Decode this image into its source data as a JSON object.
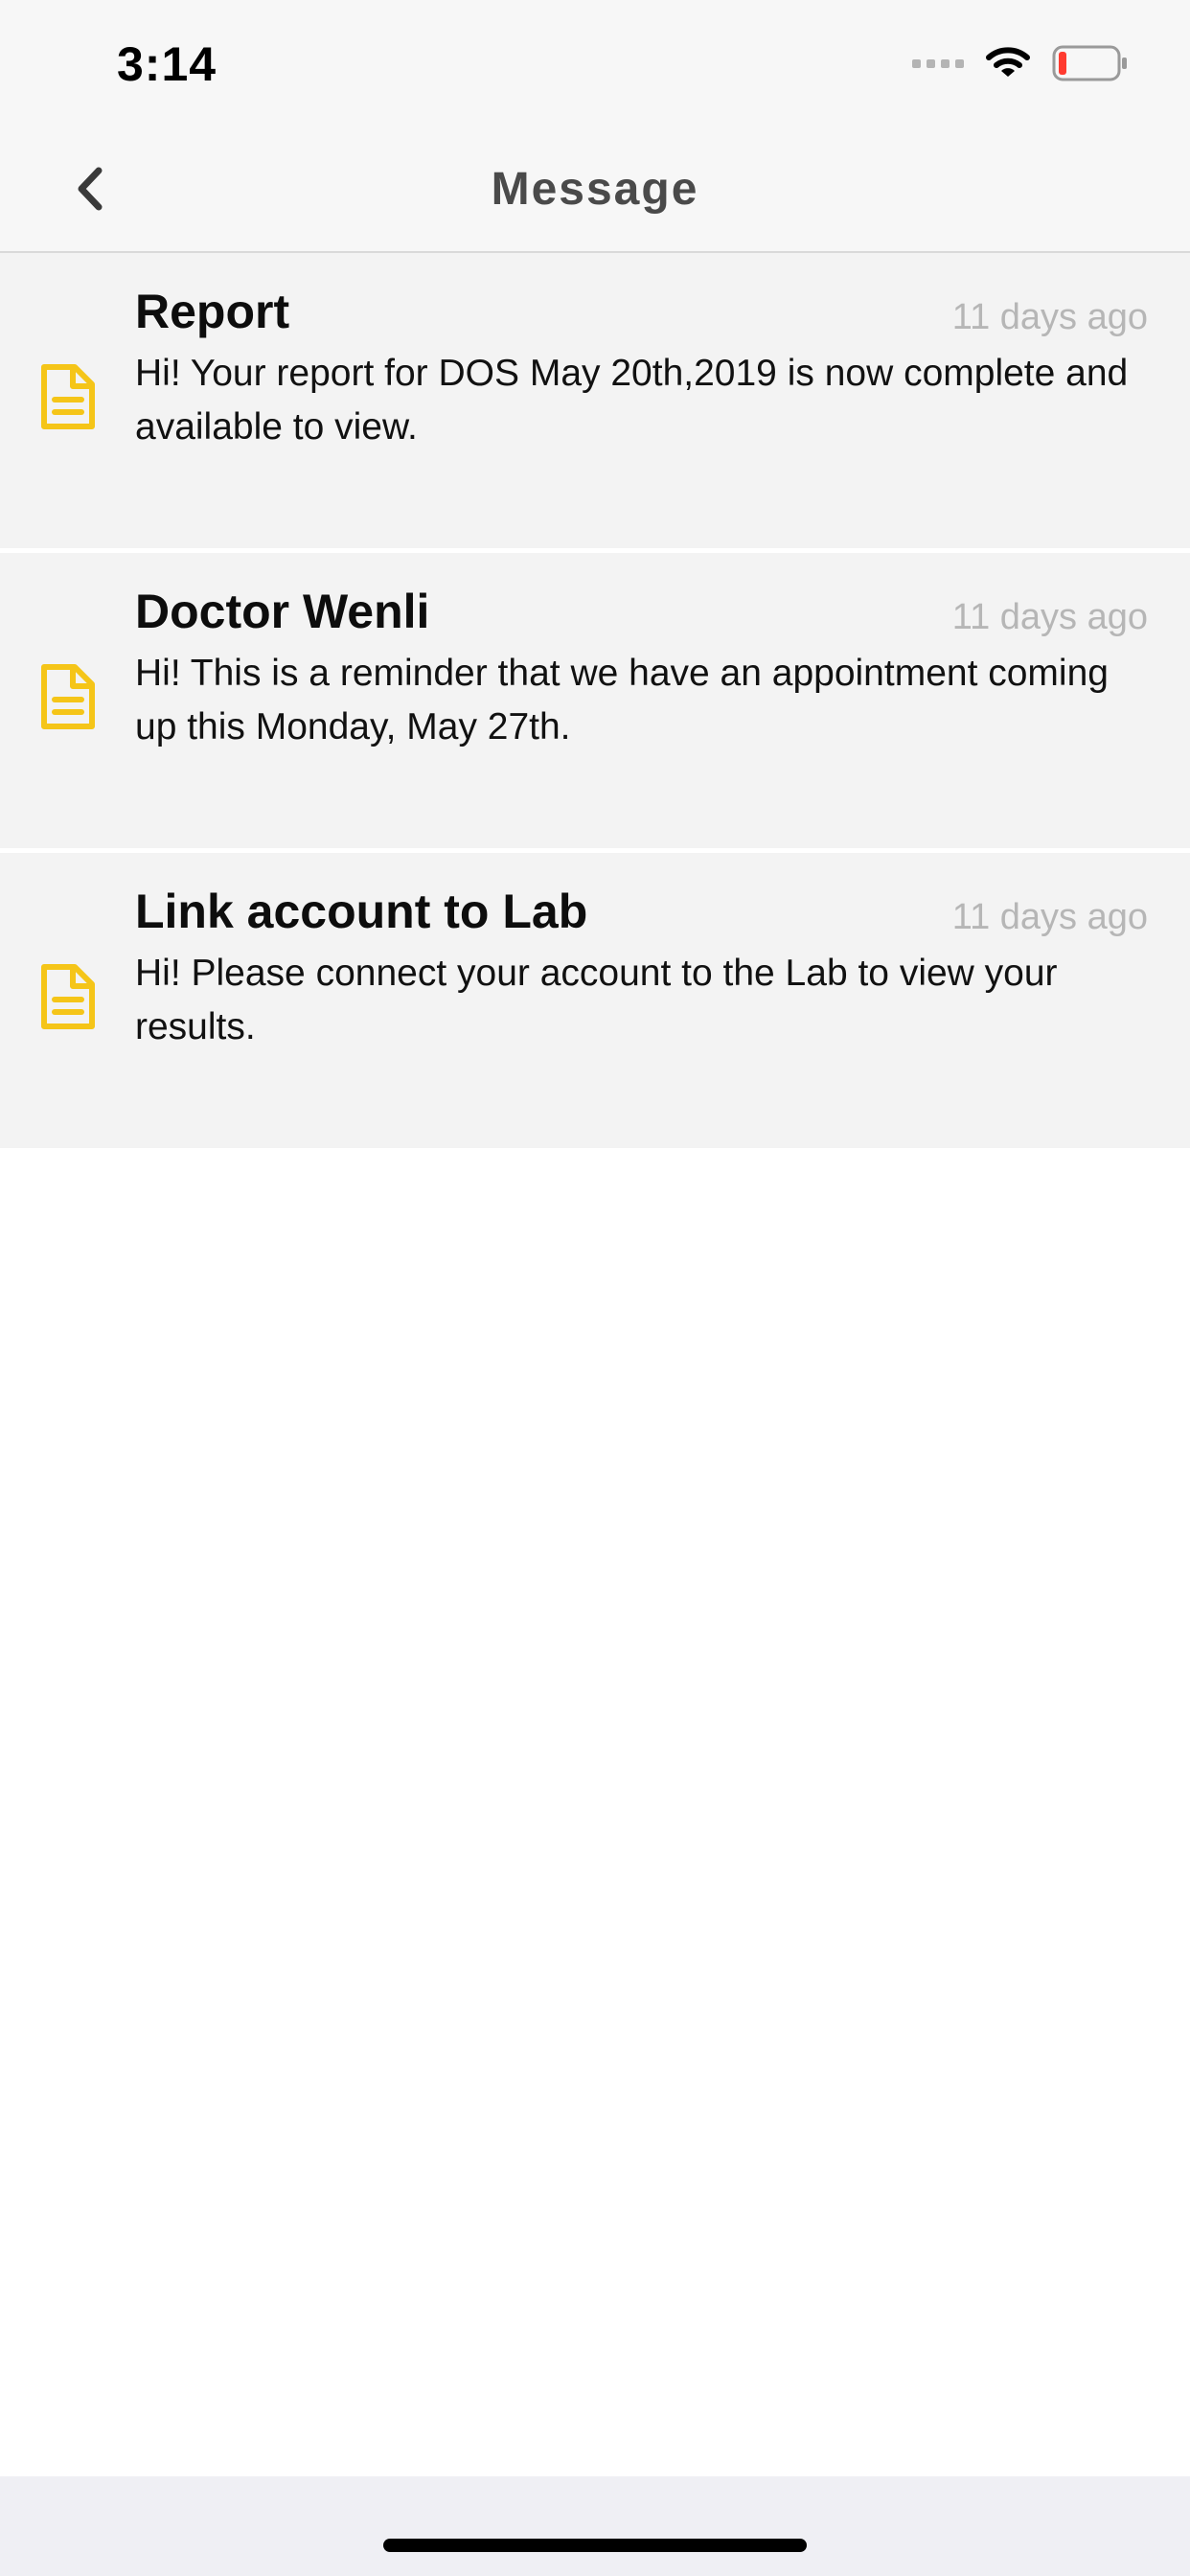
{
  "status_bar": {
    "time": "3:14"
  },
  "nav": {
    "title": "Message"
  },
  "colors": {
    "accent_icon": "#f5c518",
    "battery_low": "#ff3b30"
  },
  "messages": [
    {
      "title": "Report",
      "time": "11 days ago",
      "body": "Hi! Your report for DOS May 20th,2019 is now complete and available to view.",
      "icon": "document-icon"
    },
    {
      "title": "Doctor Wenli",
      "time": "11 days ago",
      "body": "Hi! This is a reminder that we have an appointment coming up this Monday, May 27th.",
      "icon": "document-icon"
    },
    {
      "title": "Link account to Lab",
      "time": "11 days ago",
      "body": "Hi! Please connect your account to the Lab to view your results.",
      "icon": "document-icon"
    }
  ]
}
